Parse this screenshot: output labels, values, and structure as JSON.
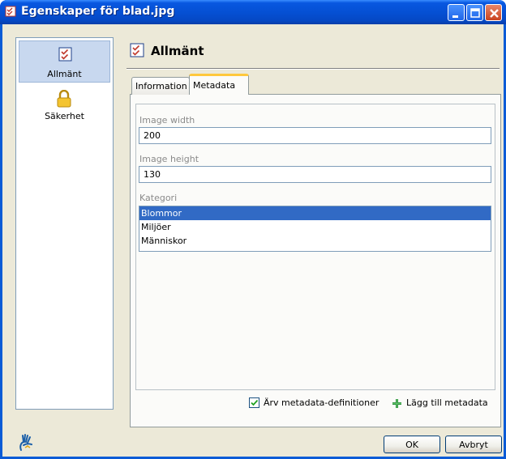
{
  "window": {
    "title": "Egenskaper för blad.jpg"
  },
  "nav": {
    "items": [
      {
        "label": "Allmänt",
        "icon": "checklist-icon",
        "selected": true
      },
      {
        "label": "Säkerhet",
        "icon": "padlock-icon",
        "selected": false
      }
    ]
  },
  "header": {
    "title": "Allmänt"
  },
  "tabs": [
    {
      "label": "Information",
      "active": false
    },
    {
      "label": "Metadata",
      "active": true
    }
  ],
  "form": {
    "image_width": {
      "label": "Image width",
      "value": "200"
    },
    "image_height": {
      "label": "Image height",
      "value": "130"
    },
    "category": {
      "label": "Kategori",
      "options": [
        "Blommor",
        "Miljöer",
        "Människor"
      ],
      "selected": "Blommor"
    }
  },
  "options": {
    "inherit_label": "Ärv metadata-definitioner",
    "inherit_checked": true,
    "add_metadata_label": "Lägg till metadata"
  },
  "buttons": {
    "ok": "OK",
    "cancel": "Avbryt"
  },
  "colors": {
    "titlebar": "#0550d4",
    "selection": "#316ac5",
    "active_tab_accent": "#ffc83c"
  }
}
